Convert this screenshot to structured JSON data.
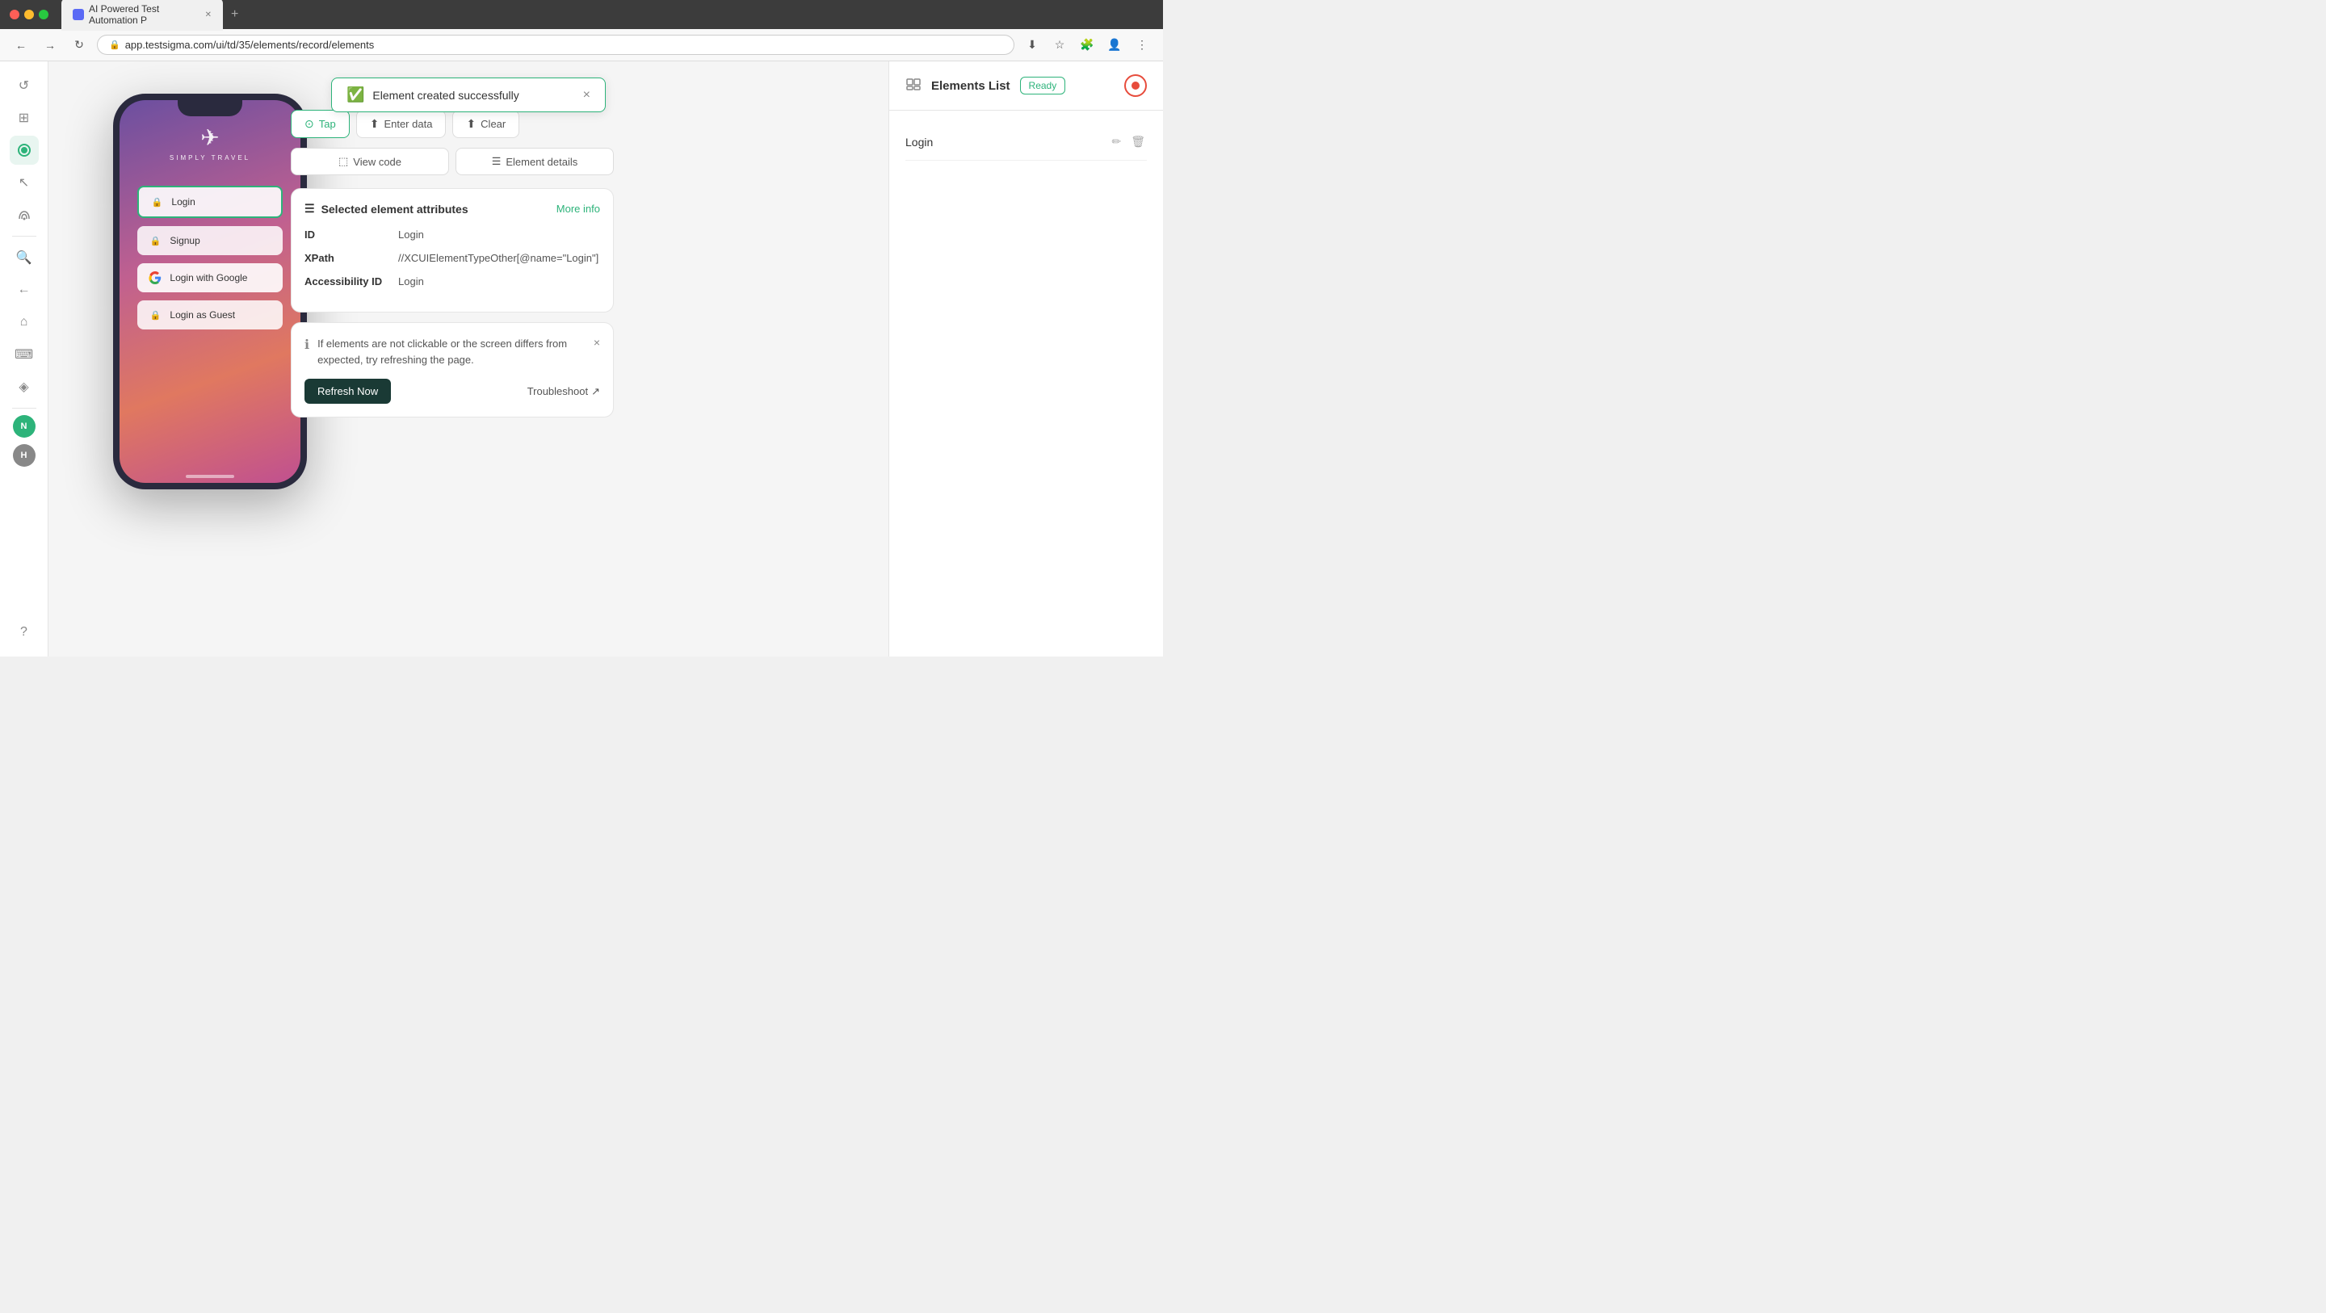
{
  "browser": {
    "tab_title": "AI Powered Test Automation P",
    "url": "app.testsigma.com/ui/td/35/elements/record/elements",
    "tab_new_label": "+",
    "nav_back": "←",
    "nav_forward": "→",
    "nav_refresh": "↻"
  },
  "notification": {
    "message": "Element created successfully",
    "close_label": "×"
  },
  "phone": {
    "logo_text": "SIMPLY TRAVEL",
    "login_label": "Login",
    "signup_label": "Signup",
    "google_label": "Login with Google",
    "guest_label": "Login as Guest"
  },
  "controls": {
    "tap_label": "Tap",
    "enter_data_label": "Enter data",
    "clear_label": "Clear",
    "view_code_label": "View code",
    "element_details_label": "Element details"
  },
  "attributes_panel": {
    "title": "Selected element attributes",
    "more_info_label": "More info",
    "id_key": "ID",
    "id_value": "Login",
    "xpath_key": "XPath",
    "xpath_value": "//XCUIElementTypeOther[@name=\"Login\"]",
    "accessibility_key": "Accessibility ID",
    "accessibility_value": "Login"
  },
  "info_panel": {
    "message": "If elements are not clickable or the screen differs from expected, try refreshing the page.",
    "refresh_label": "Refresh Now",
    "troubleshoot_label": "Troubleshoot"
  },
  "elements_list": {
    "title": "Elements List",
    "status": "Ready",
    "items": [
      {
        "name": "Login"
      }
    ]
  },
  "sidebar": {
    "icons": [
      {
        "name": "refresh-icon",
        "symbol": "↺"
      },
      {
        "name": "grid-icon",
        "symbol": "⊞"
      },
      {
        "name": "record-icon",
        "symbol": "◎",
        "active": true
      },
      {
        "name": "cursor-icon",
        "symbol": "↖"
      },
      {
        "name": "signal-icon",
        "symbol": "◎"
      },
      {
        "name": "search-icon",
        "symbol": "🔍"
      },
      {
        "name": "back-icon",
        "symbol": "←"
      },
      {
        "name": "home-icon",
        "symbol": "⌂"
      },
      {
        "name": "keyboard-icon",
        "symbol": "⌨"
      },
      {
        "name": "layer-icon",
        "symbol": "◈"
      },
      {
        "name": "n-label",
        "symbol": "N"
      },
      {
        "name": "h-label",
        "symbol": "H"
      },
      {
        "name": "help-icon",
        "symbol": "?"
      }
    ]
  }
}
